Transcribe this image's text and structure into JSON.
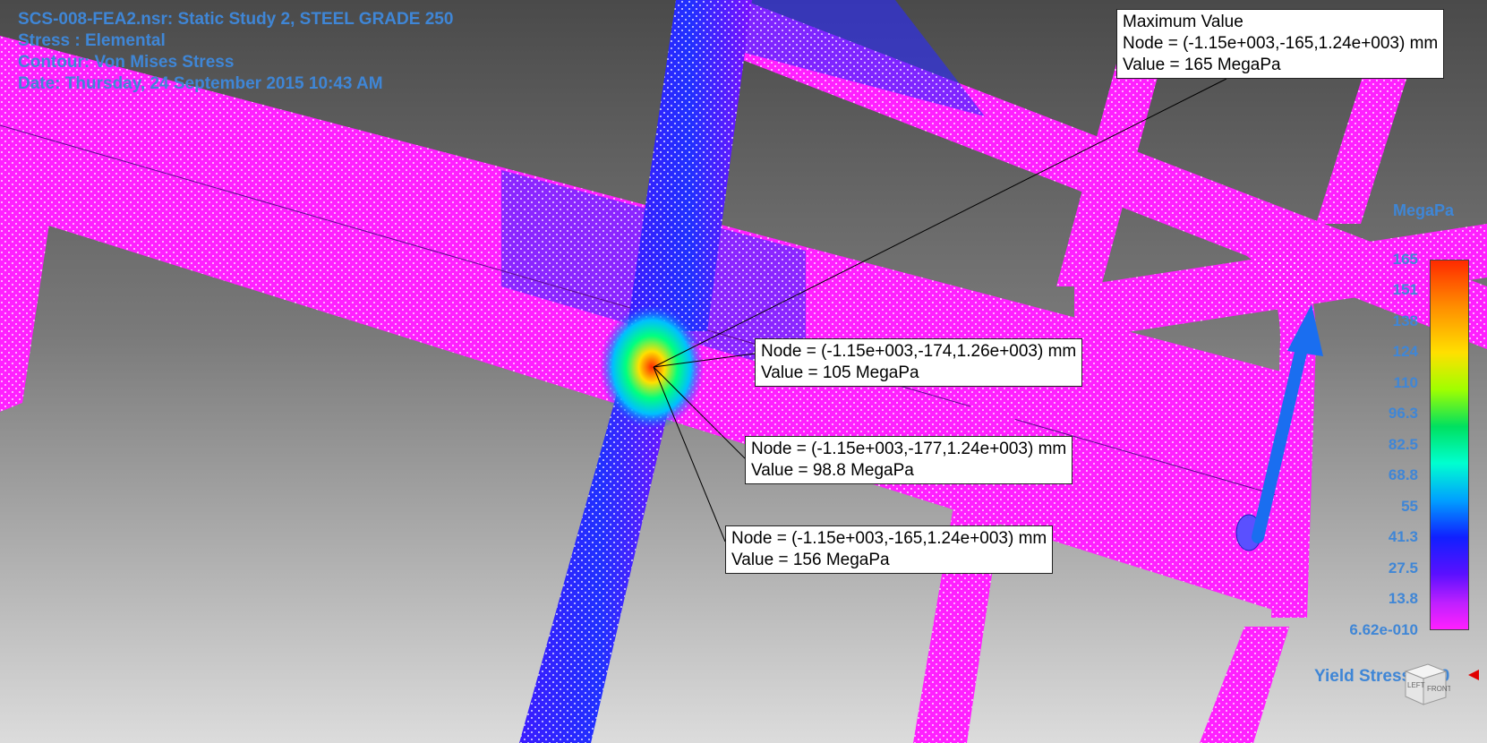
{
  "header": {
    "line1": "SCS-008-FEA2.nsr: Static Study 2, STEEL GRADE 250",
    "line2": "Stress : Elemental",
    "line3": "Contour: Von Mises Stress",
    "line4": "Date: Thursday, 24 September 2015 10:43 AM"
  },
  "max_callout": {
    "title": "Maximum Value",
    "node": "Node = (-1.15e+003,-165,1.24e+003) mm",
    "value": "Value = 165 MegaPa"
  },
  "probes": [
    {
      "node": "Node = (-1.15e+003,-174,1.26e+003) mm",
      "value": "Value = 105 MegaPa"
    },
    {
      "node": "Node = (-1.15e+003,-177,1.24e+003) mm",
      "value": "Value = 98.8 MegaPa"
    },
    {
      "node": "Node = (-1.15e+003,-165,1.24e+003) mm",
      "value": "Value = 156 MegaPa"
    }
  ],
  "legend": {
    "unit": "MegaPa",
    "ticks": [
      "165",
      "151",
      "138",
      "124",
      "110",
      "96.3",
      "82.5",
      "68.8",
      "55",
      "41.3",
      "27.5",
      "13.8",
      "6.62e-010"
    ],
    "colors": {
      "high": "#ff2a00",
      "low": "#ff20ff"
    }
  },
  "yield": {
    "label": "Yield Stress: 250",
    "marker_color": "#e00000"
  },
  "view_cube": {
    "left": "LEFT",
    "front": "FRONT"
  },
  "colors": {
    "mesh": "#ff20ff",
    "accent_text": "#3f86d6"
  }
}
